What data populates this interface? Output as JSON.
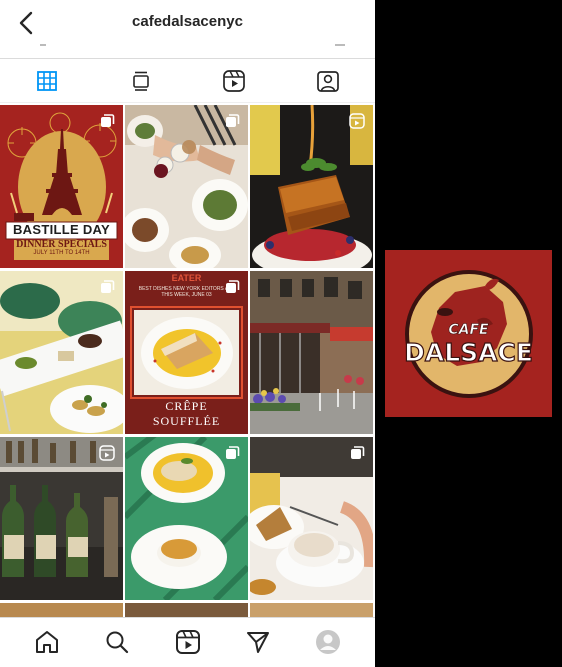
{
  "header": {
    "title": "cafedalsacenyc",
    "back_icon": "chevron-left-icon"
  },
  "profile_tabs": [
    {
      "name": "grid",
      "icon": "grid-icon",
      "active": true,
      "color": "#0095f6"
    },
    {
      "name": "feed",
      "icon": "feed-icon",
      "active": false
    },
    {
      "name": "reels",
      "icon": "reels-icon",
      "active": false
    },
    {
      "name": "tagged",
      "icon": "tagged-icon",
      "active": false
    }
  ],
  "posts": [
    {
      "badge": "carousel",
      "title": "BASTILLE DAY",
      "subtitle": "DINNER SPECIALS",
      "dates": "JULY 11TH TO 14TH"
    },
    {
      "badge": "carousel"
    },
    {
      "badge": "reel"
    },
    {
      "badge": "carousel"
    },
    {
      "badge": "carousel",
      "kicker": "EATER",
      "caption": "BEST DISHES NEW YORK EDITORS ATE THIS WEEK, JUNE 03",
      "dish_line1": "CRÊPE",
      "dish_line2": "SOUFFLÉE"
    },
    {
      "badge": "none"
    },
    {
      "badge": "reel"
    },
    {
      "badge": "carousel"
    },
    {
      "badge": "carousel"
    }
  ],
  "bottom_nav": [
    "home-icon",
    "search-icon",
    "reels-icon",
    "direct-icon",
    "profile-avatar"
  ],
  "logo": {
    "line1": "CAFE",
    "line2": "DALSACE",
    "background": "#a5231f"
  },
  "colors": {
    "brand_red": "#a5231f",
    "gold": "#d9a84e"
  }
}
